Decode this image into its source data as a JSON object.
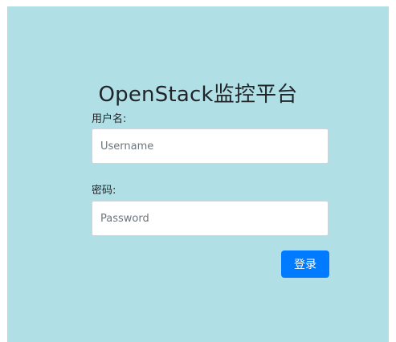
{
  "login": {
    "title": "OpenStack监控平台",
    "username_label": "用户名:",
    "username_placeholder": "Username",
    "username_value": "",
    "password_label": "密码:",
    "password_placeholder": "Password",
    "password_value": "",
    "submit_label": "登录"
  },
  "colors": {
    "panel_background": "#b0e0e6",
    "primary_button": "#007bff"
  }
}
